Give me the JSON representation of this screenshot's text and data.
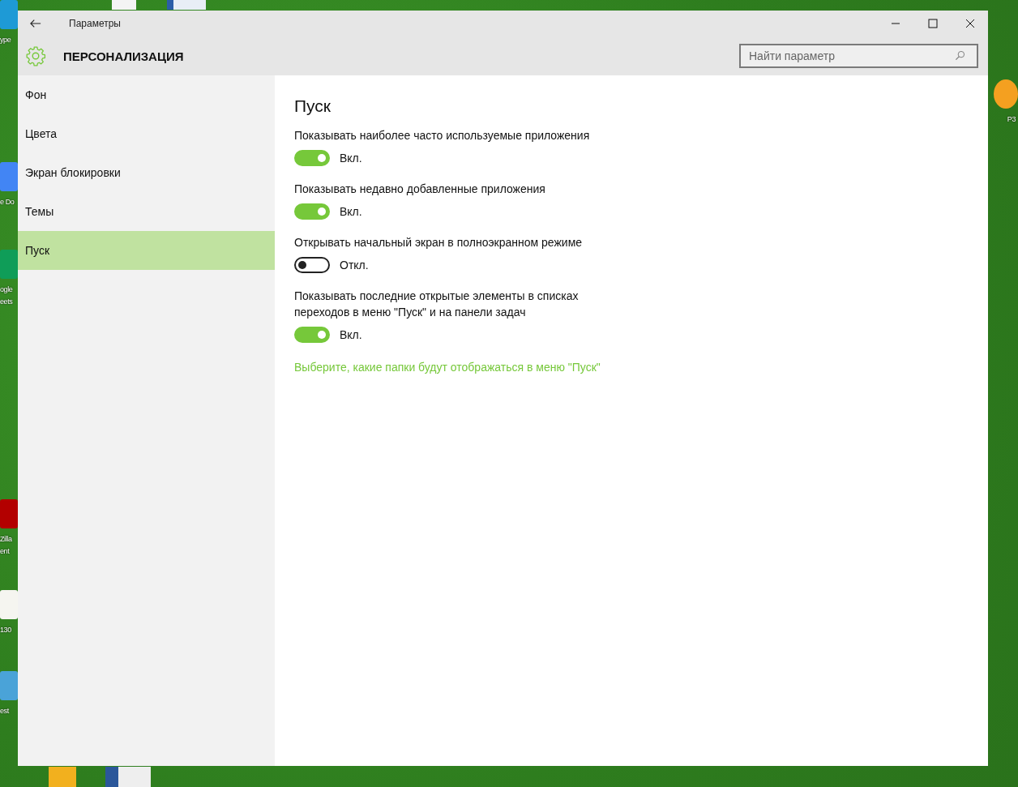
{
  "desktop_icons": [
    {
      "label": "ype",
      "color": "#1e9ad6"
    },
    {
      "label": "e Do",
      "color": "#4285f4"
    },
    {
      "label": "ogle eets",
      "color": "#0f9d58"
    },
    {
      "label": "Zilla ent",
      "color": "#b30000"
    },
    {
      "label": "130",
      "color": "#f5f5f0"
    },
    {
      "label": "est",
      "color": "#4aa3d8"
    },
    {
      "label": "P3",
      "color": "#f4a020"
    }
  ],
  "window": {
    "title": "Параметры"
  },
  "header": {
    "title": "ПЕРСОНАЛИЗАЦИЯ"
  },
  "search": {
    "placeholder": "Найти параметр"
  },
  "sidebar": {
    "items": [
      {
        "label": "Фон",
        "selected": false
      },
      {
        "label": "Цвета",
        "selected": false
      },
      {
        "label": "Экран блокировки",
        "selected": false
      },
      {
        "label": "Темы",
        "selected": false
      },
      {
        "label": "Пуск",
        "selected": true
      }
    ]
  },
  "page": {
    "title": "Пуск"
  },
  "settings": [
    {
      "label": "Показывать наиболее часто используемые приложения",
      "on": true,
      "state_text": "Вкл."
    },
    {
      "label": "Показывать недавно добавленные приложения",
      "on": true,
      "state_text": "Вкл."
    },
    {
      "label": "Открывать начальный экран в полноэкранном режиме",
      "on": false,
      "state_text": "Откл."
    },
    {
      "label": "Показывать последние открытые элементы в списках переходов в меню \"Пуск\" и на панели задач",
      "on": true,
      "state_text": "Вкл."
    }
  ],
  "link": "Выберите, какие папки будут отображаться в меню \"Пуск\""
}
